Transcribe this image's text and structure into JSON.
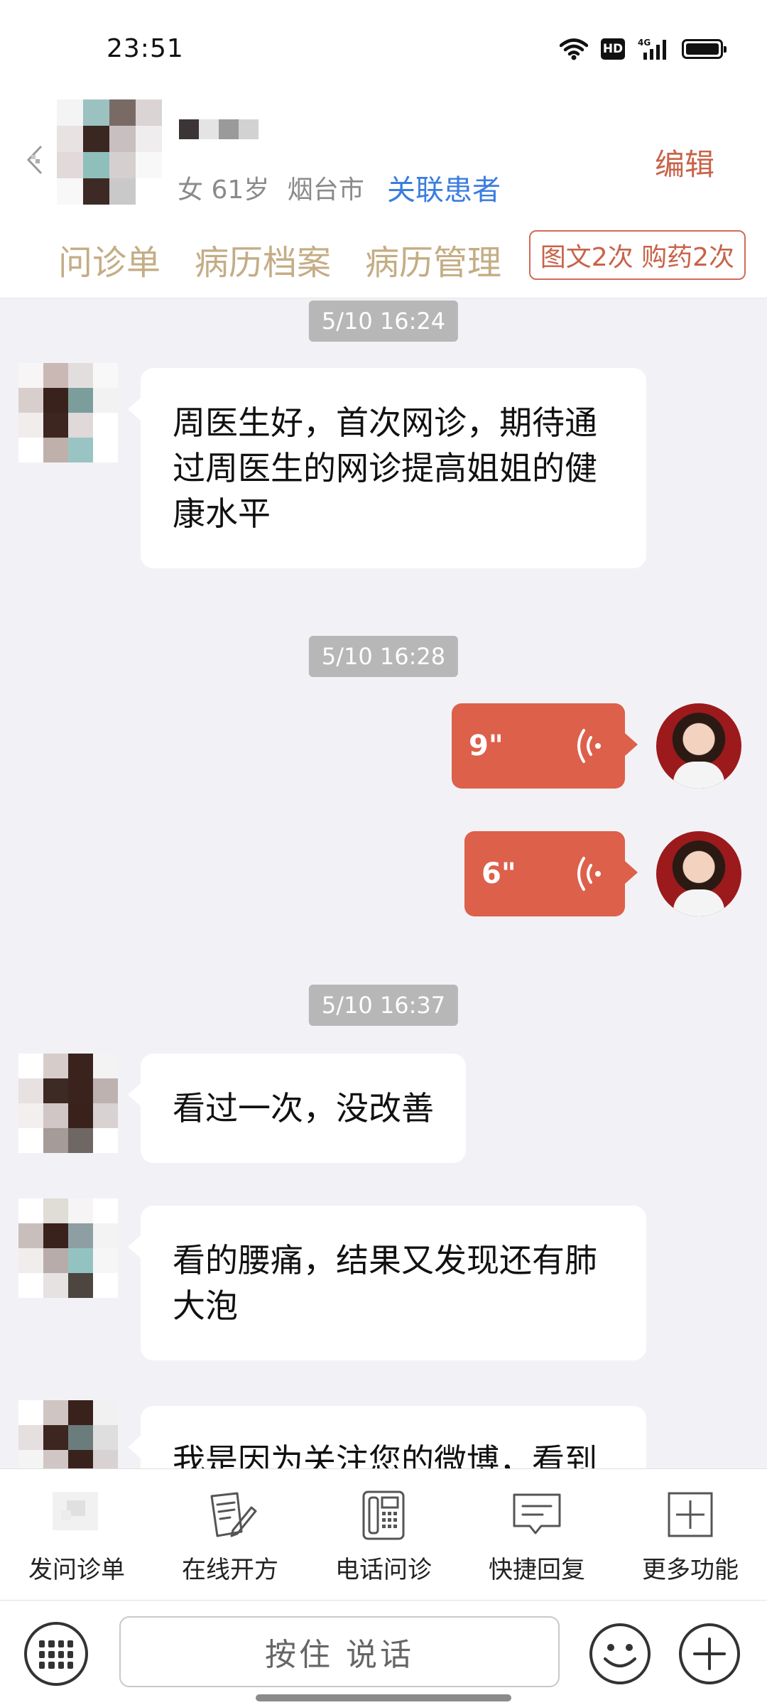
{
  "status_bar": {
    "time": "23:51",
    "network": "4G",
    "hd": "HD"
  },
  "header": {
    "gender_age": "女 61岁",
    "city": "烟台市",
    "link_patient": "关联患者",
    "edit": "编辑",
    "tabs": [
      "问诊单",
      "病历档案",
      "病历管理"
    ],
    "service_badge": "图文2次 购药2次"
  },
  "chat": {
    "timestamps": [
      "5/10 16:24",
      "5/10 16:28",
      "5/10 16:37"
    ],
    "messages": [
      {
        "from": "patient",
        "text": "周医生好，首次网诊，期待通过周医生的网诊提高姐姐的健康水平"
      },
      {
        "from": "doctor",
        "type": "voice",
        "duration": "9\""
      },
      {
        "from": "doctor",
        "type": "voice",
        "duration": "6\""
      },
      {
        "from": "patient",
        "text": "看过一次，没改善"
      },
      {
        "from": "patient",
        "text": "看的腰痛，结果又发现还有肺大泡"
      },
      {
        "from": "patient",
        "text": "我是因为关注您的微博，看到"
      }
    ]
  },
  "toolbar": [
    {
      "label": "发问诊单",
      "icon": "clipboard-icon"
    },
    {
      "label": "在线开方",
      "icon": "prescription-pen-icon"
    },
    {
      "label": "电话问诊",
      "icon": "phone-icon"
    },
    {
      "label": "快捷回复",
      "icon": "chat-bubble-icon"
    },
    {
      "label": "更多功能",
      "icon": "plus-square-icon"
    }
  ],
  "input_bar": {
    "hold_to_talk": "按住 说话"
  },
  "colors": {
    "accent_red": "#dd604b",
    "link_blue": "#3b7de0",
    "tab_gold": "#c4ad85",
    "bg": "#f2f2f6"
  }
}
